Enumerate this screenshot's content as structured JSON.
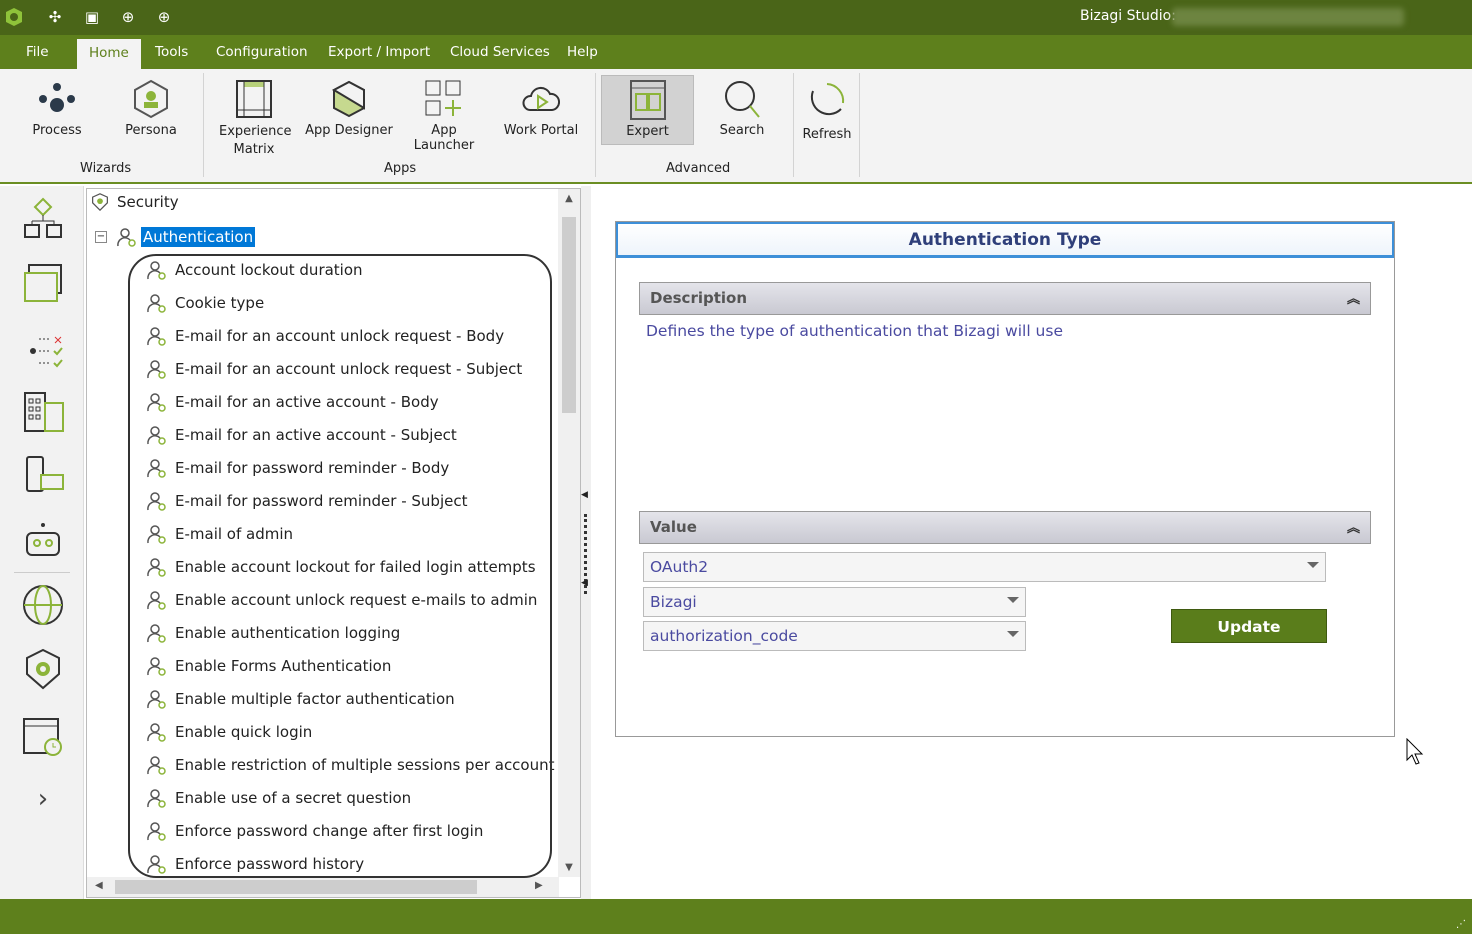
{
  "titlebar": {
    "app_title": "Bizagi Studio:",
    "quick_access": [
      "bizagi-logo-icon",
      "process-icon",
      "layout-icon",
      "download-icon",
      "upload-icon"
    ]
  },
  "menu": [
    "File",
    "Home",
    "Tools",
    "Configuration",
    "Export / Import",
    "Cloud Services",
    "Help"
  ],
  "ribbon": {
    "buttons": [
      "Process",
      "Persona",
      "Experience Matrix",
      "App Designer",
      "App Launcher",
      "Work Portal",
      "Expert",
      "Search",
      "Refresh"
    ],
    "groups": [
      "Wizards",
      "Apps",
      "Advanced"
    ]
  },
  "leftnav": [
    "process-wizard-icon",
    "forms-icon",
    "rules-icon",
    "organization-icon",
    "devices-icon",
    "robot-icon",
    "globe-icon",
    "security-icon",
    "scheduler-icon",
    "expand-icon"
  ],
  "tree": {
    "root": "Security",
    "selected": "Authentication",
    "items": [
      "Account lockout duration",
      "Cookie type",
      "E-mail for an account unlock request - Body",
      "E-mail for an account unlock request - Subject",
      "E-mail for an active account - Body",
      "E-mail for an active account - Subject",
      "E-mail for password reminder - Body",
      "E-mail for password reminder - Subject",
      "E-mail of admin",
      "Enable account lockout for failed login attempts",
      "Enable account unlock request e-mails to admin",
      "Enable authentication logging",
      "Enable Forms Authentication",
      "Enable multiple factor authentication",
      "Enable quick login",
      "Enable restriction of multiple sessions per account",
      "Enable use of a secret question",
      "Enforce password change after first login",
      "Enforce password history"
    ]
  },
  "panel": {
    "title": "Authentication Type",
    "description_header": "Description",
    "description": "Defines the type of authentication that Bizagi will use",
    "value_header": "Value",
    "auth_type": "OAuth2",
    "provider": "Bizagi",
    "grant_type": "authorization_code",
    "update_label": "Update"
  },
  "colors": {
    "titlebar": "#4a6518",
    "menubar": "#5e801c",
    "accent": "#5a7d1b",
    "header_border": "#3d8fd8",
    "selection": "#0078d7"
  }
}
